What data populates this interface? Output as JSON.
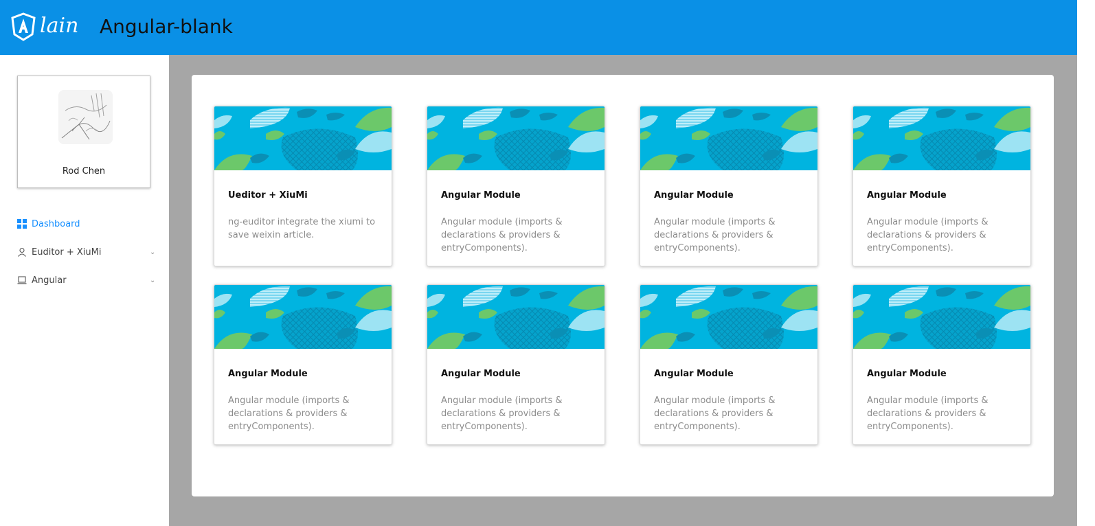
{
  "header": {
    "logo_text": "lain",
    "app_title": "Angular-blank"
  },
  "profile": {
    "name": "Rod Chen"
  },
  "menu": {
    "items": [
      {
        "label": "Dashboard",
        "icon": "dashboard-icon",
        "active": true
      },
      {
        "label": "Euditor + XiuMi",
        "icon": "user-icon",
        "expandable": true
      },
      {
        "label": "Angular",
        "icon": "laptop-icon",
        "expandable": true
      }
    ]
  },
  "cards": [
    {
      "title": "Ueditor + XiuMi",
      "description": "ng-euditor integrate the xiumi to save weixin article."
    },
    {
      "title": "Angular Module",
      "description": "Angular module (imports & declarations & providers & entryComponents)."
    },
    {
      "title": "Angular Module",
      "description": "Angular module (imports & declarations & providers & entryComponents)."
    },
    {
      "title": "Angular Module",
      "description": "Angular module (imports & declarations & providers & entryComponents)."
    },
    {
      "title": "Angular Module",
      "description": "Angular module (imports & declarations & providers & entryComponents)."
    },
    {
      "title": "Angular Module",
      "description": "Angular module (imports & declarations & providers & entryComponents)."
    },
    {
      "title": "Angular Module",
      "description": "Angular module (imports & declarations & providers & entryComponents)."
    },
    {
      "title": "Angular Module",
      "description": "Angular module (imports & declarations & providers & entryComponents)."
    }
  ],
  "colors": {
    "header_bg": "#0a90e6",
    "accent": "#1890ff",
    "cover_bg": "#00b4e0",
    "cover_green": "#6cc86a",
    "cover_light": "#9de3f3"
  }
}
